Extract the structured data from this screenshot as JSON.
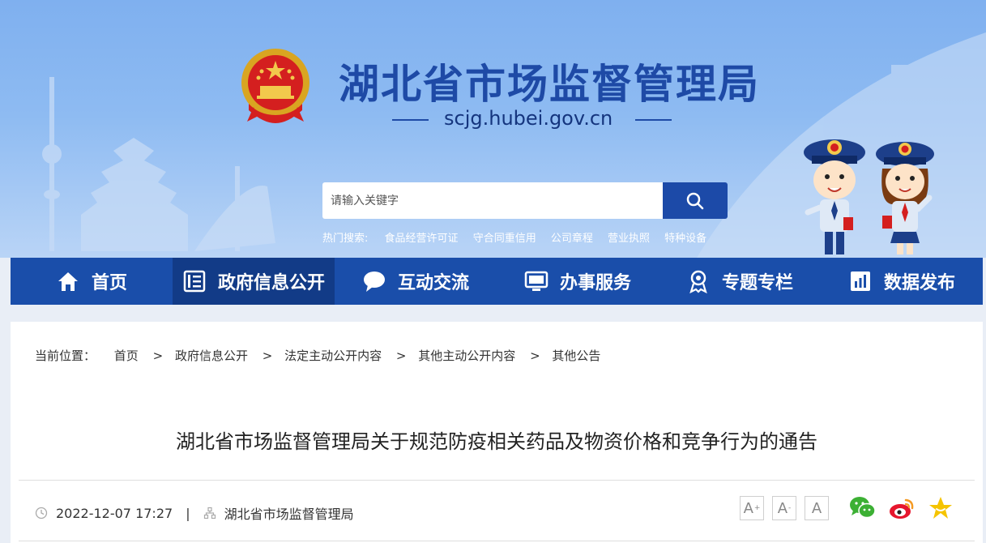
{
  "header": {
    "site_title": "湖北省市场监督管理局",
    "site_url": "scjg.hubei.gov.cn",
    "search": {
      "placeholder": "请输入关键字"
    },
    "hot_search": {
      "label": "热门搜索:",
      "terms": [
        "食品经营许可证",
        "守合同重信用",
        "公司章程",
        "营业执照",
        "特种设备"
      ]
    }
  },
  "nav": {
    "items": [
      {
        "label": "首页",
        "icon": "home-icon"
      },
      {
        "label": "政府信息公开",
        "icon": "document-list-icon"
      },
      {
        "label": "互动交流",
        "icon": "chat-bubble-icon"
      },
      {
        "label": "办事服务",
        "icon": "monitor-icon"
      },
      {
        "label": "专题专栏",
        "icon": "badge-icon"
      },
      {
        "label": "数据发布",
        "icon": "bar-chart-icon"
      }
    ],
    "active": "政府信息公开"
  },
  "breadcrumb": {
    "label": "当前位置：",
    "items": [
      "首页",
      "政府信息公开",
      "法定主动公开内容",
      "其他主动公开内容",
      "其他公告"
    ],
    "separator": ">"
  },
  "article": {
    "title": "湖北省市场监督管理局关于规范防疫相关药品及物资价格和竞争行为的通告",
    "date": "2022-12-07 17:27",
    "meta_separator": "|",
    "source": "湖北省市场监督管理局"
  },
  "tools": {
    "font_buttons": [
      "A",
      "A",
      "A"
    ],
    "share_icons": [
      "wechat-icon",
      "weibo-icon",
      "favorite-star-icon"
    ]
  },
  "colors": {
    "nav_bg": "#1a4eaa",
    "nav_active": "#123b87",
    "title_blue": "#1e4aa6",
    "search_button": "#1c4aa8"
  }
}
